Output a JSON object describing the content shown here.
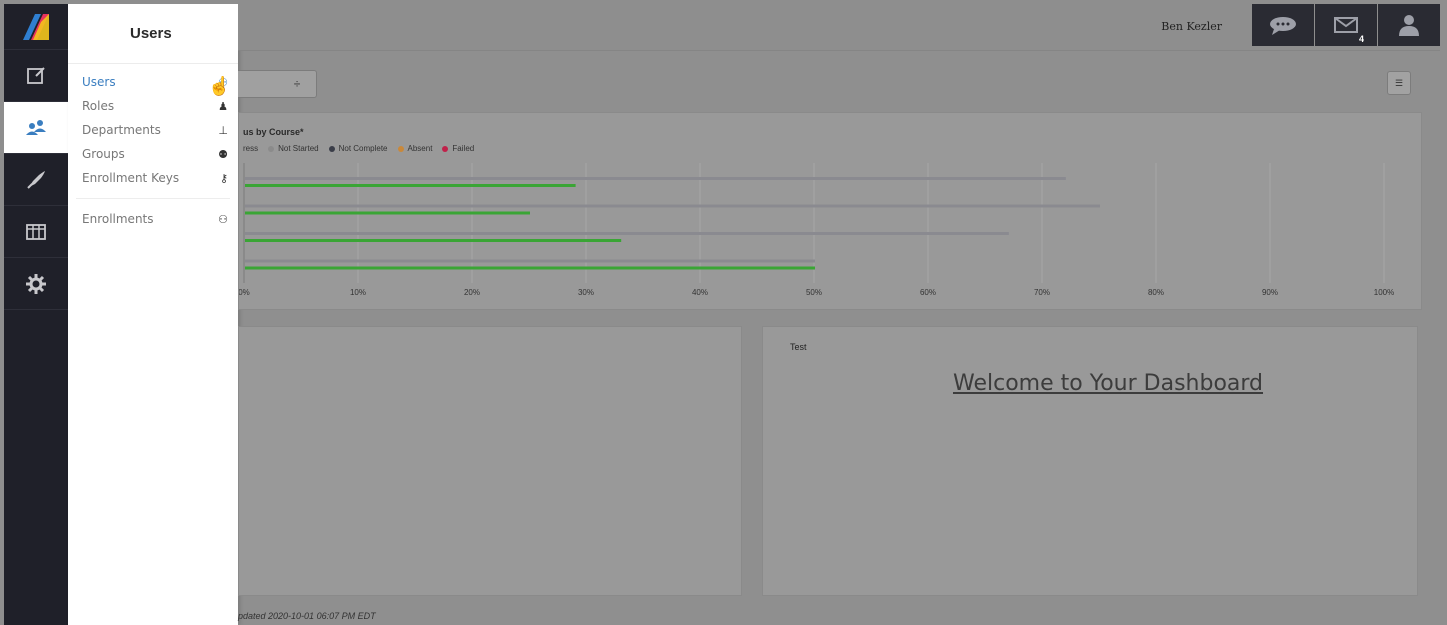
{
  "header": {
    "user_name": "Ben Kezler",
    "messages_count": "4"
  },
  "flyout": {
    "title": "Users",
    "items": [
      {
        "label": "Users",
        "icon": "users-icon",
        "active": true
      },
      {
        "label": "Roles",
        "icon": "role-icon"
      },
      {
        "label": "Departments",
        "icon": "org-chart-icon"
      },
      {
        "label": "Groups",
        "icon": "group-icon"
      },
      {
        "label": "Enrollment Keys",
        "icon": "key-icon"
      },
      {
        "label": "Enrollments",
        "icon": "enrollments-icon"
      }
    ]
  },
  "rail": {
    "items": [
      "logo-icon",
      "courses-icon",
      "users-icon",
      "launch-icon",
      "table-icon",
      "settings-icon"
    ],
    "active": "users-icon"
  },
  "toolbar": {
    "select_value": "÷"
  },
  "colors": {
    "green": "#3aa535",
    "gray_bar": "#8a8a90",
    "accent": "#3a7ec0"
  },
  "chart_data": {
    "type": "bar",
    "orientation": "horizontal",
    "title": "us by Course*",
    "legend": [
      "ress",
      "Not Started",
      "Not Complete",
      "Absent",
      "Failed"
    ],
    "legend_colors": [
      "#6a7d9e",
      "#8b8b8b",
      "#3a3d48",
      "#c9883a",
      "#c0214a"
    ],
    "xlim": [
      0,
      100
    ],
    "x_ticks": [
      "0%",
      "10%",
      "20%",
      "30%",
      "40%",
      "50%",
      "60%",
      "70%",
      "80%",
      "90%",
      "100%"
    ],
    "series": [
      {
        "color": "#8a8a90",
        "values": [
          72,
          75,
          67,
          50
        ]
      },
      {
        "color": "#3aa535",
        "values": [
          29,
          25,
          33,
          50
        ]
      }
    ],
    "grid": true
  },
  "panels": {
    "right_label": "Test",
    "welcome": "Welcome to Your Dashboard"
  },
  "footer": "pdated 2020-10-01 06:07 PM EDT"
}
